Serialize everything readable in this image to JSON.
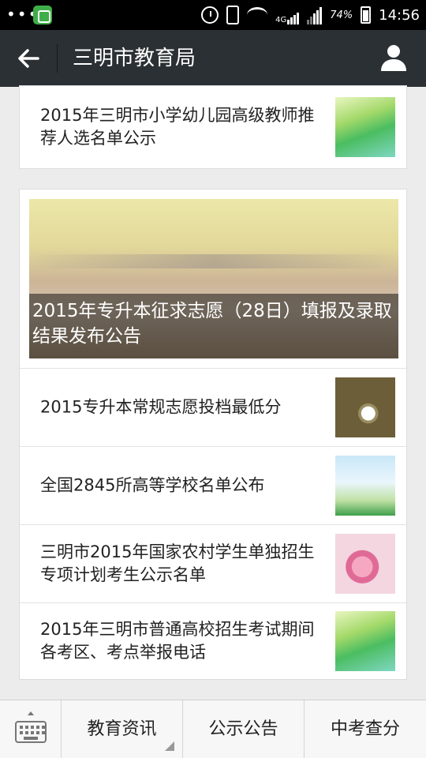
{
  "status_bar": {
    "time": "14:56",
    "battery_pct": "74%",
    "network": "4G"
  },
  "header": {
    "title": "三明市教育局"
  },
  "articles_top": [
    {
      "title": "2015年三明市小学幼儿园高级教师推荐人选名单公示",
      "thumb": "leaf"
    }
  ],
  "featured": {
    "title": "2015年专升本征求志愿（28日）填报及录取结果发布公告"
  },
  "articles": [
    {
      "title": "2015专升本常规志愿投档最低分",
      "thumb": "cup"
    },
    {
      "title": "全国2845所高等学校名单公布",
      "thumb": "sky"
    },
    {
      "title": "三明市2015年国家农村学生单独招生专项计划考生公示名单",
      "thumb": "tulip"
    },
    {
      "title": "2015年三明市普通高校招生考试期间各考区、考点举报电话",
      "thumb": "leaf"
    }
  ],
  "bottom_menu": [
    {
      "label": "教育资讯"
    },
    {
      "label": "公示公告"
    },
    {
      "label": "中考查分"
    }
  ]
}
